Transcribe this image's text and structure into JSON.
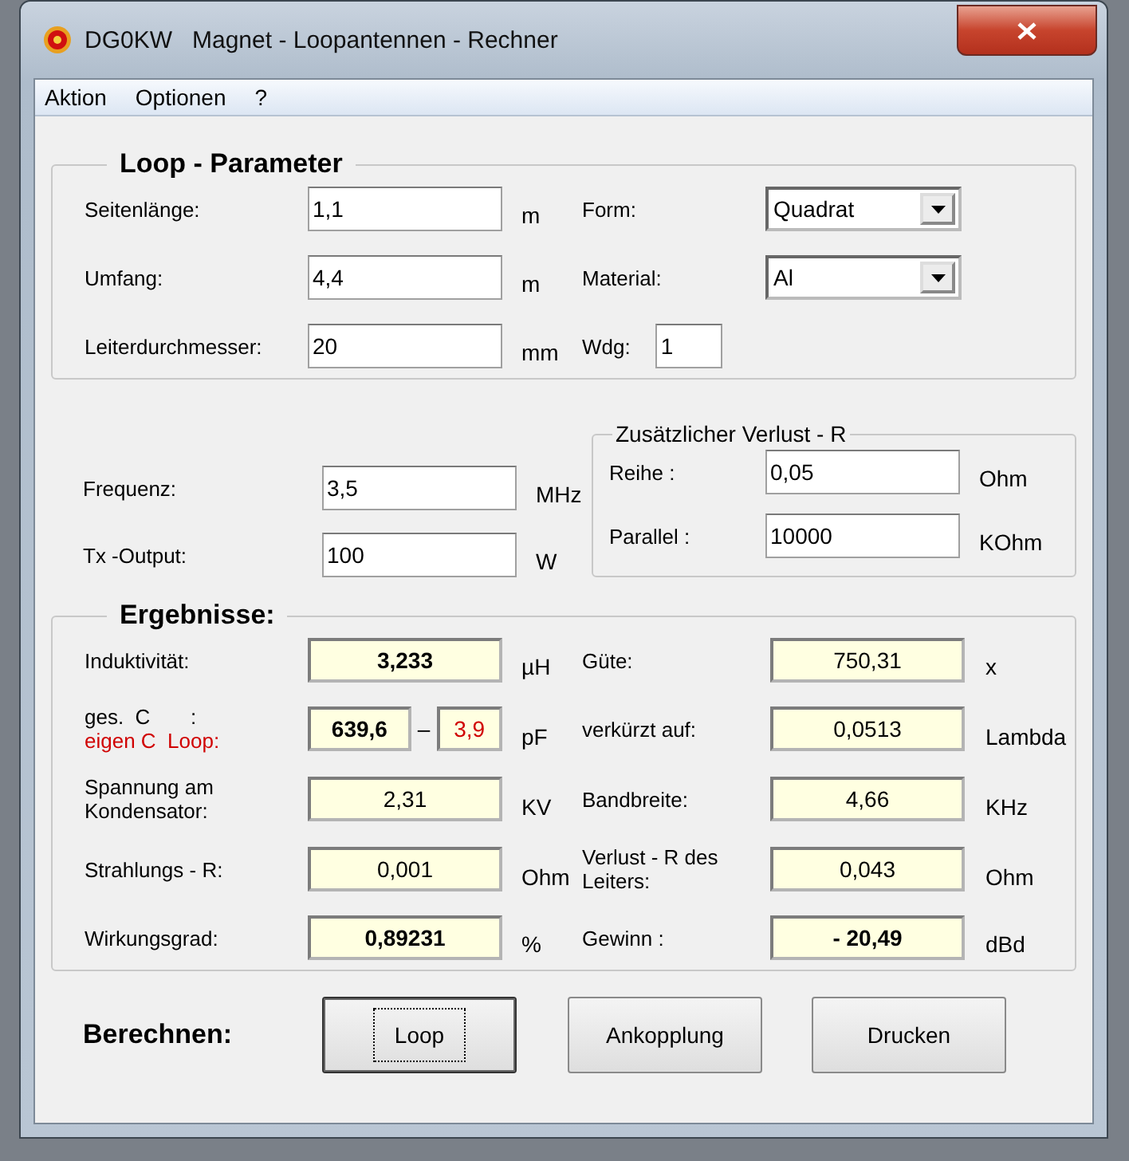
{
  "window": {
    "title": "DG0KW   Magnet - Loopantennen - Rechner"
  },
  "menu": [
    {
      "label": "Aktion"
    },
    {
      "label": "Optionen"
    },
    {
      "label": "?"
    }
  ],
  "loop_parameter": {
    "title": "Loop - Parameter",
    "rows": [
      {
        "left": {
          "label": "Seitenlänge:",
          "value": "1,1",
          "unit": "m"
        },
        "right": {
          "kind": "combo",
          "label": "Form:",
          "value": "Quadrat"
        }
      },
      {
        "left": {
          "label": "Umfang:",
          "value": "4,4",
          "unit": "m"
        },
        "right": {
          "kind": "combo",
          "label": "Material:",
          "value": "Al"
        }
      },
      {
        "left": {
          "label": "Leiterdurchmesser:",
          "value": "20",
          "unit": "mm"
        },
        "right": {
          "kind": "input",
          "label": "Wdg:",
          "value": "1"
        }
      }
    ]
  },
  "inputs": {
    "rows": [
      {
        "label": "Frequenz:",
        "value": "3,5",
        "unit": "MHz"
      },
      {
        "label": "Tx -Output:",
        "value": "100",
        "unit": "W"
      }
    ],
    "extra_loss": {
      "title": "Zusätzlicher Verlust - R",
      "rows": [
        {
          "label": "Reihe :",
          "value": "0,05",
          "unit": "Ohm"
        },
        {
          "label": "Parallel :",
          "value": "10000",
          "unit": "KOhm"
        }
      ]
    }
  },
  "results": {
    "title": "Ergebnisse:",
    "rows": [
      {
        "left": {
          "kind": "single",
          "label": "Induktivität:",
          "value": "3,233",
          "bold": true,
          "unit": "µH"
        },
        "right": {
          "label": "Güte:",
          "value": "750,31",
          "bold": false,
          "unit": "x"
        }
      },
      {
        "left": {
          "kind": "capacitance",
          "label": "ges.  C       :",
          "label_2": "eigen C  Loop:",
          "value": "639,6",
          "bold": true,
          "separator": "–",
          "value_2": "3,9",
          "unit": "pF"
        },
        "right": {
          "label": "verkürzt auf:",
          "value": "0,0513",
          "bold": false,
          "unit": "Lambda"
        }
      },
      {
        "left": {
          "kind": "single",
          "label": "Spannung am Kondensator:",
          "value": "2,31",
          "bold": false,
          "unit": "KV"
        },
        "right": {
          "label": "Bandbreite:",
          "value": "4,66",
          "bold": false,
          "unit": "KHz"
        }
      },
      {
        "left": {
          "kind": "single",
          "label": "Strahlungs - R:",
          "value": "0,001",
          "bold": false,
          "unit": "Ohm"
        },
        "right": {
          "label": "Verlust - R des Leiters:",
          "value": "0,043",
          "bold": false,
          "unit": "Ohm"
        }
      },
      {
        "left": {
          "kind": "single",
          "label": "Wirkungsgrad:",
          "value": "0,89231",
          "bold": true,
          "unit": "%"
        },
        "right": {
          "label": "Gewinn :",
          "value": "- 20,49",
          "bold": true,
          "unit": "dBd"
        }
      }
    ]
  },
  "calculate": {
    "label": "Berechnen:",
    "buttons": [
      {
        "label": "Loop",
        "focused": true
      },
      {
        "label": "Ankopplung",
        "focused": false
      },
      {
        "label": "Drucken",
        "focused": false
      }
    ]
  }
}
